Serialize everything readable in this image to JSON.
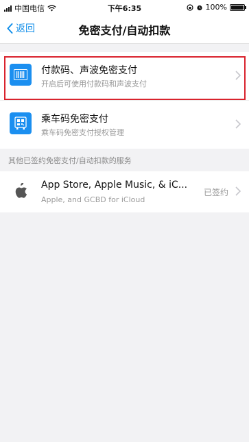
{
  "status_bar": {
    "carrier": "中国电信",
    "time": "下午6:35",
    "battery": "100%",
    "battery_level": 1.0
  },
  "nav": {
    "back_label": "返回",
    "title": "免密支付/自动扣款"
  },
  "rows": [
    {
      "title": "付款码、声波免密支付",
      "subtitle": "开启后可使用付款码和声波支付",
      "icon": "barcode-icon",
      "highlighted": true
    },
    {
      "title": "乘车码免密支付",
      "subtitle": "乘车码免密支付授权管理",
      "icon": "qr-bus-icon"
    }
  ],
  "section_label": "其他已签约免密支付/自动扣款的服务",
  "services": [
    {
      "title": "App Store, Apple Music, & iC...",
      "subtitle": "Apple, and GCBD for iCloud",
      "status": "已签约",
      "icon": "apple-icon"
    }
  ],
  "colors": {
    "accent": "#108ee9",
    "icon_bg": "#1b8ff0",
    "highlight_border": "#d9232d",
    "background": "#f2f2f4"
  }
}
